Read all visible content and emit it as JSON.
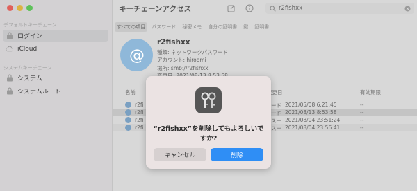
{
  "sidebar": {
    "default_section": "デフォルトキーチェーン",
    "system_section": "システムキーチェーン",
    "items": [
      {
        "label": "ログイン",
        "icon": "lock-icon"
      },
      {
        "label": "iCloud",
        "icon": "cloud-icon"
      },
      {
        "label": "システム",
        "icon": "lock-icon"
      },
      {
        "label": "システムルート",
        "icon": "lock-icon"
      }
    ]
  },
  "toolbar": {
    "title": "キーチェーンアクセス"
  },
  "search": {
    "value": "r2fishxx"
  },
  "filters": [
    "すべての項目",
    "パスワード",
    "秘密メモ",
    "自分の証明書",
    "鍵",
    "証明書"
  ],
  "detail": {
    "name": "r2fishxx",
    "kind": "種類: ネットワークパスワード",
    "account": "アカウント: hiroomi",
    "where": "場所: smb://r2fishxx",
    "modified": "変更日: 2021/08/13 8:53:58"
  },
  "table": {
    "headers": {
      "name": "名前",
      "kind": "",
      "modified": "変更日",
      "expires": "有効期限"
    },
    "rows": [
      {
        "name": "r2fi",
        "kind": "ード",
        "modified": "2021/05/08 6:21:45",
        "expires": "--"
      },
      {
        "name": "r2fi",
        "kind": "ード",
        "modified": "2021/08/13 8:53:58",
        "expires": "--"
      },
      {
        "name": "r2fi",
        "kind": "スー",
        "modified": "2021/08/04 23:51:24",
        "expires": "--"
      },
      {
        "name": "r2fi",
        "kind": "スー",
        "modified": "2021/08/04 23:56:41",
        "expires": "--"
      }
    ]
  },
  "dialog": {
    "message": "“r2fishxx”を削除してもよろしいですか?",
    "cancel_label": "キャンセル",
    "delete_label": "削除",
    "icon": "keychain-app-icon"
  },
  "colors": {
    "accent": "#2f8ef5",
    "traffic_red": "#e0605a",
    "traffic_yellow": "#dcb343",
    "traffic_green": "#5ec15a"
  }
}
